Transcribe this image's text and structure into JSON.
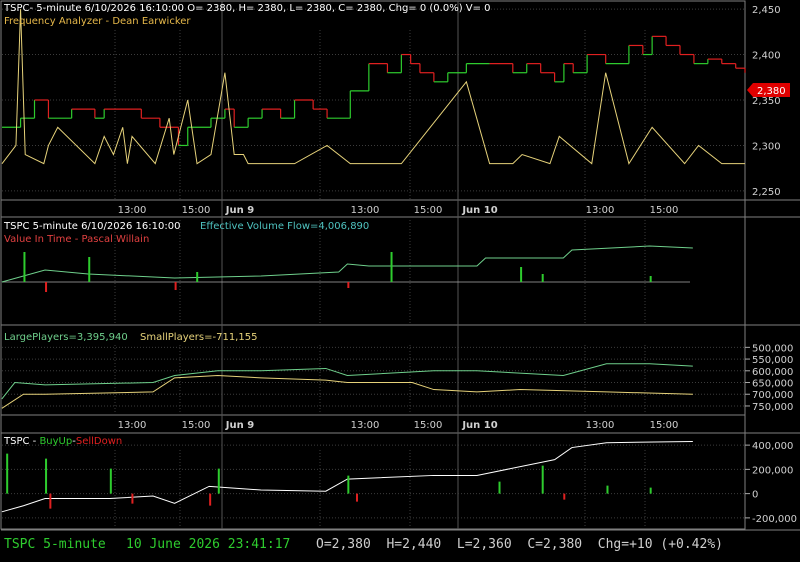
{
  "colors": {
    "bg": "#000000",
    "frame": "#7f7f7f",
    "grid": "#3c3c3c",
    "white": "#ffffff",
    "green": "#2ecc2e",
    "red": "#e02020",
    "yellow": "#e6d27a",
    "teal": "#6fd08c",
    "badge": "#e00000"
  },
  "panel1": {
    "header": "TSPC- 5-minute 6/10/2026 16:10:00 O= 2380, H= 2380, L= 2380, C= 2380, Chg= 0 (0.0%) V= 0",
    "subtitle": "Frequency Analyzer - Dean Earwicker",
    "price_badge": "2,380",
    "y_ticks": [
      "2,450",
      "2,400",
      "2,350",
      "2,300",
      "2,250"
    ]
  },
  "panel2": {
    "header_name": "TSPC 5-minute  6/10/2026 16:10:00",
    "header_indicator": "Effective Volume Flow=4,006,890",
    "subtitle": "Value In Time - Pascal Willain"
  },
  "panel3": {
    "large_label": "LargePlayers=3,395,940",
    "small_label": "SmallPlayers=-711,155",
    "y_ticks": [
      "500,000",
      "550,000",
      "600,000",
      "650,000",
      "700,000",
      "750,000"
    ]
  },
  "panel4": {
    "title_name": "TSPC - ",
    "title_buy": "BuyUp",
    "title_sep": "-",
    "title_sell": "SellDown",
    "y_ticks": [
      "400,000",
      "200,000",
      "0",
      "-200,000"
    ]
  },
  "x_axis": {
    "labels": [
      "13:00",
      "15:00",
      "Jun 9",
      "13:00",
      "15:00",
      "Jun 10",
      "13:00",
      "15:00"
    ]
  },
  "status_bar": {
    "name": "TSPC  5-minute",
    "date": "10 June 2026 23:41:17",
    "ohlc": "O=2,380  H=2,440  L=2,360  C=2,380  Chg=+10 (+0.42%)"
  },
  "chart_data": [
    {
      "type": "line",
      "title": "Frequency Analyzer - Dean Earwicker",
      "ylim": [
        2240,
        2460
      ],
      "series": [
        {
          "name": "",
          "kind": "step-price",
          "x": [
            0,
            4,
            7,
            10,
            15,
            20,
            22,
            30,
            34,
            38,
            40,
            45,
            48,
            50,
            53,
            56,
            60,
            63,
            67,
            70,
            75,
            79,
            83,
            86,
            88,
            90,
            93,
            96,
            100,
            105,
            110,
            113,
            116,
            119,
            121,
            123,
            126,
            130,
            135,
            138,
            140,
            143,
            146,
            149,
            152,
            155,
            158,
            160
          ],
          "values": [
            2320,
            2330,
            2350,
            2330,
            2340,
            2330,
            2340,
            2330,
            2320,
            2300,
            2320,
            2330,
            2340,
            2320,
            2330,
            2340,
            2330,
            2350,
            2340,
            2330,
            2360,
            2390,
            2380,
            2400,
            2390,
            2380,
            2370,
            2380,
            2390,
            2390,
            2380,
            2390,
            2380,
            2370,
            2390,
            2380,
            2400,
            2390,
            2410,
            2400,
            2420,
            2410,
            2400,
            2390,
            2395,
            2390,
            2385,
            2380
          ]
        },
        {
          "name": "",
          "kind": "spike",
          "x": [
            0,
            3,
            4,
            5,
            9,
            10,
            12,
            20,
            22,
            24,
            26,
            27,
            28,
            33,
            36,
            37,
            40,
            42,
            45,
            48,
            50,
            52,
            53,
            56,
            60,
            63,
            70,
            75,
            77,
            80,
            86,
            100,
            105,
            110,
            112,
            118,
            120,
            127,
            130,
            135,
            140,
            147,
            150,
            155,
            160
          ],
          "values": [
            2280,
            2300,
            2450,
            2290,
            2280,
            2300,
            2320,
            2280,
            2310,
            2290,
            2320,
            2280,
            2310,
            2280,
            2330,
            2290,
            2350,
            2280,
            2290,
            2380,
            2290,
            2290,
            2280,
            2280,
            2280,
            2280,
            2300,
            2280,
            2280,
            2280,
            2280,
            2370,
            2280,
            2280,
            2290,
            2280,
            2310,
            2280,
            2380,
            2280,
            2320,
            2280,
            2300,
            2280,
            2280
          ]
        }
      ]
    },
    {
      "type": "line",
      "title": "Value In Time - Pascal Willain",
      "series": [
        {
          "name": "Effective Volume Flow",
          "x": [
            0,
            10,
            20,
            40,
            60,
            78,
            80,
            85,
            110,
            112,
            130,
            132,
            150,
            160
          ],
          "values": [
            0.2,
            0.5,
            0.4,
            0.3,
            0.35,
            0.45,
            0.65,
            0.6,
            0.6,
            0.8,
            0.8,
            1.0,
            1.1,
            1.05
          ]
        }
      ]
    },
    {
      "type": "line",
      "ylim": [
        490000,
        780000
      ],
      "series": [
        {
          "name": "LargePlayers",
          "x": [
            0,
            3,
            10,
            35,
            40,
            50,
            60,
            75,
            80,
            100,
            110,
            130,
            140,
            150,
            160
          ],
          "values": [
            720000,
            650000,
            660000,
            650000,
            620000,
            600000,
            600000,
            590000,
            620000,
            600000,
            600000,
            620000,
            570000,
            570000,
            580000
          ]
        },
        {
          "name": "SmallPlayers",
          "x": [
            0,
            5,
            10,
            35,
            40,
            50,
            60,
            75,
            80,
            95,
            100,
            110,
            120,
            140,
            160
          ],
          "values": [
            760000,
            700000,
            700000,
            690000,
            630000,
            620000,
            630000,
            640000,
            650000,
            650000,
            680000,
            690000,
            680000,
            690000,
            700000
          ]
        }
      ]
    },
    {
      "type": "bar",
      "ylim": [
        -300000,
        500000
      ],
      "series": [
        {
          "name": "BuyUp-SellDown",
          "x": [
            0,
            5,
            10,
            25,
            35,
            40,
            48,
            60,
            75,
            80,
            100,
            110,
            128,
            132,
            140,
            160
          ],
          "values": [
            -150000,
            -100000,
            -40000,
            -40000,
            -20000,
            -80000,
            60000,
            30000,
            20000,
            120000,
            150000,
            150000,
            280000,
            380000,
            420000,
            430000
          ]
        }
      ]
    }
  ]
}
